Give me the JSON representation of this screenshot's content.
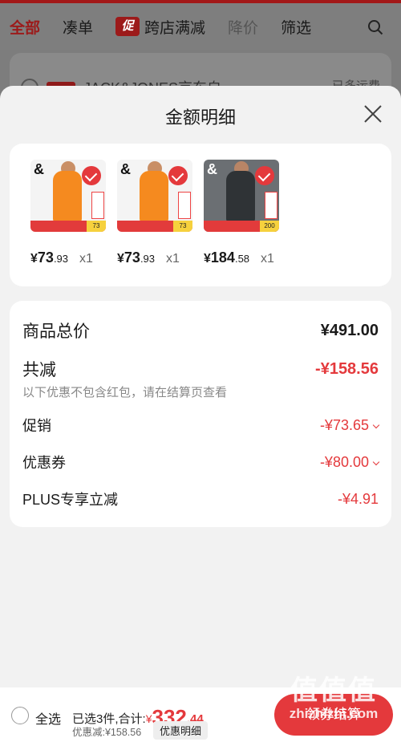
{
  "bg_tabs": {
    "all": "全部",
    "bundle": "凑单",
    "promo_tag": "促",
    "cross_store": "跨店满减",
    "price_drop": "降价",
    "filter": "筛选"
  },
  "bg_store": {
    "name": "JACK&JONES京东自",
    "right": "已多运费"
  },
  "sheet": {
    "title": "金额明细",
    "products": [
      {
        "yuan_sym": "¥",
        "int": "73",
        "dec": ".93",
        "qty": "x1",
        "strip_label": "73"
      },
      {
        "yuan_sym": "¥",
        "int": "73",
        "dec": ".93",
        "qty": "x1",
        "strip_label": "73"
      },
      {
        "yuan_sym": "¥",
        "int": "184",
        "dec": ".58",
        "qty": "x1",
        "strip_label": "200"
      }
    ],
    "summary": {
      "total_label": "商品总价",
      "total_value": "¥491.00",
      "reduce_label": "共减",
      "reduce_value": "-¥158.56",
      "hint": "以下优惠不包含红包，请在结算页查看",
      "promo_label": "促销",
      "promo_value": "-¥73.65",
      "coupon_label": "优惠券",
      "coupon_value": "-¥80.00",
      "plus_label": "PLUS专享立减",
      "plus_value": "-¥4.91"
    }
  },
  "bottom": {
    "select_all": "全选",
    "selected_text": "已选3件,合计:",
    "total_sym": "¥",
    "total_int": "332",
    "total_dec": ".44",
    "discount_text": "优惠减:¥158.56",
    "detail_btn": "优惠明细",
    "checkout": "领券结算"
  },
  "watermark": {
    "big": "值值值",
    "small": "zhizhizhi.com"
  },
  "colors": {
    "accent": "#e4393c",
    "sheet_bg": "#f2f2f2",
    "overlay": "#7d7d7d"
  }
}
